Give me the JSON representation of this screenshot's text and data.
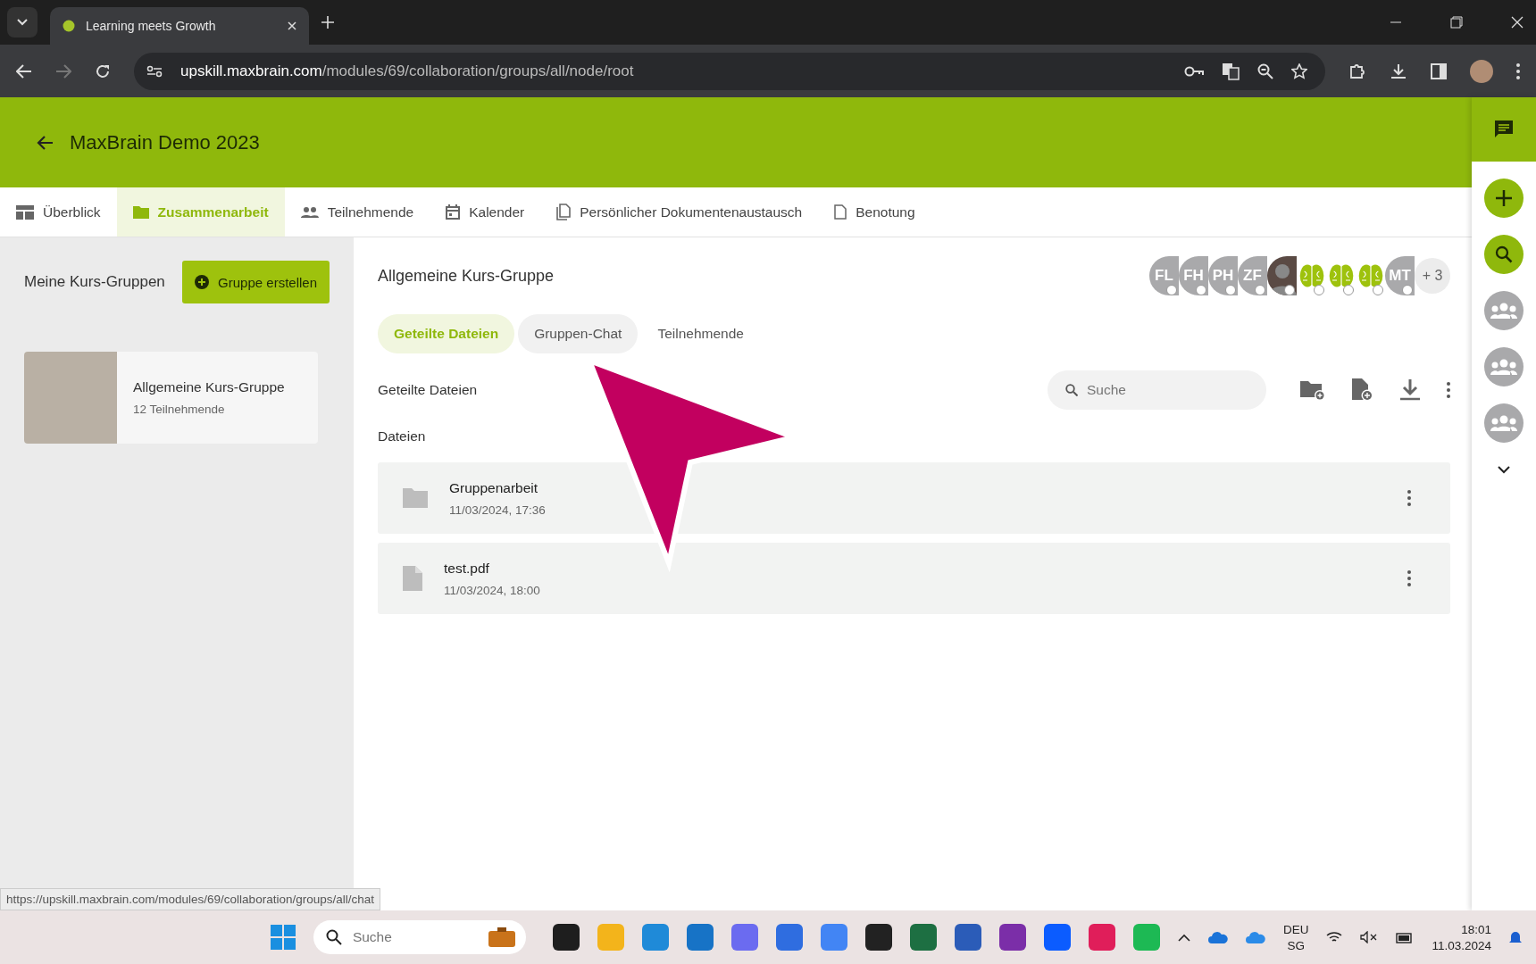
{
  "browser": {
    "tab_title": "Learning meets Growth",
    "url_host": "upskill.maxbrain.com",
    "url_path": "/modules/69/collaboration/groups/all/node/root",
    "status_link": "https://upskill.maxbrain.com/modules/69/collaboration/groups/all/chat"
  },
  "header": {
    "title": "MaxBrain Demo 2023"
  },
  "nav_tabs": [
    {
      "label": "Überblick",
      "kind": "dashboard",
      "selected": false
    },
    {
      "label": "Zusammenarbeit",
      "kind": "folder",
      "selected": true
    },
    {
      "label": "Teilnehmende",
      "kind": "people",
      "selected": false
    },
    {
      "label": "Kalender",
      "kind": "calendar",
      "selected": false
    },
    {
      "label": "Persönlicher Dokumentenaustausch",
      "kind": "docs",
      "selected": false
    },
    {
      "label": "Benotung",
      "kind": "grade",
      "selected": false
    }
  ],
  "sidebar": {
    "heading": "Meine Kurs-Gruppen",
    "create_button": "Gruppe erstellen",
    "groups": [
      {
        "name": "Allgemeine Kurs-Gruppe",
        "members": "12 Teilnehmende"
      }
    ]
  },
  "group": {
    "title": "Allgemeine Kurs-Gruppe",
    "avatars": [
      {
        "kind": "initials",
        "text": "FL"
      },
      {
        "kind": "initials",
        "text": "FH"
      },
      {
        "kind": "initials",
        "text": "PH"
      },
      {
        "kind": "initials",
        "text": "ZF"
      },
      {
        "kind": "photo"
      },
      {
        "kind": "brain"
      },
      {
        "kind": "brain"
      },
      {
        "kind": "brain"
      },
      {
        "kind": "initials",
        "text": "MT"
      }
    ],
    "more": "+ 3",
    "tabs": [
      {
        "label": "Geteilte Dateien",
        "selected": true,
        "hovered": false
      },
      {
        "label": "Gruppen-Chat",
        "selected": false,
        "hovered": true
      },
      {
        "label": "Teilnehmende",
        "selected": false,
        "hovered": false
      }
    ],
    "section": "Geteilte Dateien",
    "search": {
      "placeholder": "Suche"
    },
    "files_heading": "Dateien",
    "files": [
      {
        "kind": "folder",
        "name": "Gruppenarbeit",
        "date": "11/03/2024, 17:36"
      },
      {
        "kind": "file",
        "name": "test.pdf",
        "date": "11/03/2024, 18:00"
      }
    ]
  },
  "taskbar": {
    "search": {
      "placeholder": "Suche"
    },
    "language": "DEU",
    "region": "SG",
    "time": "18:01",
    "date": "11.03.2024"
  }
}
